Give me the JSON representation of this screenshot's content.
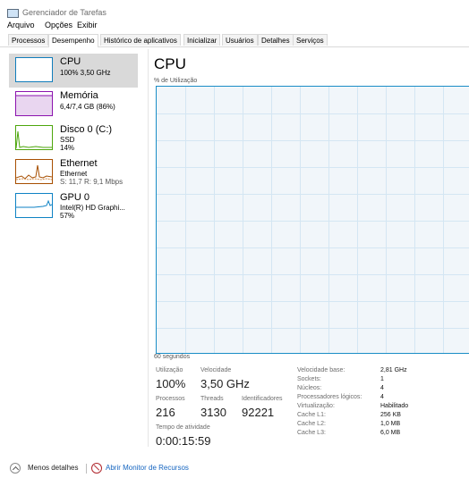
{
  "window": {
    "title": "Gerenciador de Tarefas"
  },
  "menu": [
    "Arquivo",
    "Opções",
    "Exibir"
  ],
  "tabs": [
    "Processos",
    "Desempenho",
    "Histórico de aplicativos",
    "Inicializar",
    "Usuários",
    "Detalhes",
    "Serviços"
  ],
  "active_tab": "Desempenho",
  "sidebar": {
    "items": [
      {
        "title": "CPU",
        "line1": "100% 3,50 GHz",
        "line2": "",
        "color": "#117dbb",
        "selected": true
      },
      {
        "title": "Memória",
        "line1": "6,4/7,4 GB (86%)",
        "line2": "",
        "color": "#8b12ae",
        "selected": false
      },
      {
        "title": "Disco 0 (C:)",
        "line1": "SSD",
        "line2": "14%",
        "color": "#4da60c",
        "selected": false
      },
      {
        "title": "Ethernet",
        "line1": "Ethernet",
        "line2": "S: 11,7  R: 9,1 Mbps",
        "color": "#a74f01",
        "selected": false
      },
      {
        "title": "GPU 0",
        "line1": "Intel(R) HD Graphi...",
        "line2": "57%",
        "color": "#0e82c4",
        "selected": false
      }
    ]
  },
  "main": {
    "title": "CPU",
    "util_label": "% de Utilização",
    "time_label": "60 segundos",
    "graph_color": "#117dbb",
    "stats": {
      "utilizacao_label": "Utilização",
      "utilizacao": "100%",
      "velocidade_label": "Velocidade",
      "velocidade": "3,50 GHz",
      "processos_label": "Processos",
      "processos": "216",
      "threads_label": "Threads",
      "threads": "3130",
      "identificadores_label": "Identificadores",
      "identificadores": "92221",
      "tempo_label": "Tempo de atividade",
      "tempo": "0:00:15:59"
    },
    "specs": [
      {
        "label": "Velocidade base:",
        "value": "2,81 GHz"
      },
      {
        "label": "Sockets:",
        "value": "1"
      },
      {
        "label": "Núcleos:",
        "value": "4"
      },
      {
        "label": "Processadores lógicos:",
        "value": "4"
      },
      {
        "label": "Virtualização:",
        "value": "Habilitado"
      },
      {
        "label": "Cache L1:",
        "value": "256 KB"
      },
      {
        "label": "Cache L2:",
        "value": "1,0 MB"
      },
      {
        "label": "Cache L3:",
        "value": "6,0 MB"
      }
    ]
  },
  "footer": {
    "less_details": "Menos detalhes",
    "monitor_link": "Abrir Monitor de Recursos"
  }
}
